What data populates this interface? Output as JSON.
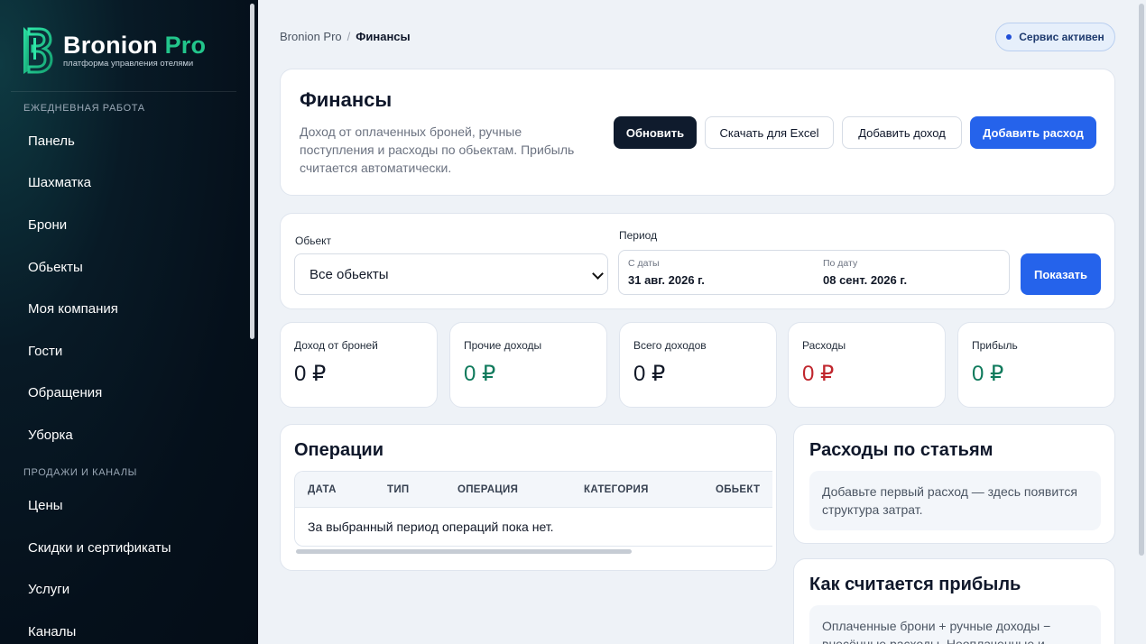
{
  "brand": {
    "name": "Bronion",
    "name_accent": "Pro",
    "tagline": "платформа управления отелями",
    "logo_letter": "B"
  },
  "sidebar": {
    "sections": [
      {
        "title": "ЕЖЕДНЕВНАЯ РАБОТА"
      },
      {
        "title": "ПРОДАЖИ И КАНАЛЫ"
      }
    ],
    "items": [
      {
        "label": "Панель"
      },
      {
        "label": "Шахматка"
      },
      {
        "label": "Брони"
      },
      {
        "label": "Обьекты"
      },
      {
        "label": "Моя компания"
      },
      {
        "label": "Гости"
      },
      {
        "label": "Обращения"
      },
      {
        "label": "Уборка"
      },
      {
        "label": "Цены"
      },
      {
        "label": "Скидки и сертификаты"
      },
      {
        "label": "Услуги"
      },
      {
        "label": "Каналы"
      }
    ]
  },
  "breadcrumb": {
    "root": "Bronion Pro",
    "separator": "/",
    "current": "Финансы"
  },
  "status": {
    "label": "Сервис активен",
    "color": "#1f4ed8"
  },
  "header": {
    "title": "Финансы",
    "description": "Доход от оплаченных броней, ручные поступления и расходы по обьектам. Прибыль считается автоматически.",
    "buttons": {
      "refresh": "Обновить",
      "export": "Скачать для Excel",
      "add_income": "Добавить доход",
      "add_expense": "Добавить расход"
    }
  },
  "filters": {
    "object_label": "Обьект",
    "object_value": "Все обьекты",
    "period_label": "Период",
    "from_label": "С даты",
    "from_value": "31 авг. 2026 г.",
    "to_label": "По дату",
    "to_value": "08 сент. 2026 г.",
    "show_button": "Показать"
  },
  "stats": [
    {
      "label": "Доход от броней",
      "value": "0 ₽",
      "color": "#111827"
    },
    {
      "label": "Прочие доходы",
      "value": "0 ₽",
      "color": "#0f7a5c"
    },
    {
      "label": "Всего доходов",
      "value": "0 ₽",
      "color": "#111827"
    },
    {
      "label": "Расходы",
      "value": "0 ₽",
      "color": "#c0262d"
    },
    {
      "label": "Прибыль",
      "value": "0 ₽",
      "color": "#0f7a5c"
    }
  ],
  "operations": {
    "title": "Операции",
    "columns": [
      "ДАТА",
      "ТИП",
      "ОПЕРАЦИЯ",
      "КАТЕГОРИЯ",
      "ОБЬЕКТ"
    ],
    "empty": "За выбранный период операций пока нет."
  },
  "expenses_by_category": {
    "title": "Расходы по статьям",
    "hint": "Добавьте первый расход — здесь появится структура затрат."
  },
  "profit_info": {
    "title": "Как считается прибыль",
    "hint": "Оплаченные брони + ручные доходы − внесённые расходы. Неоплаченные и"
  },
  "colors": {
    "accent": "#2563eb",
    "brand_green": "#22c58b",
    "dark_button": "#0f1b2d"
  }
}
